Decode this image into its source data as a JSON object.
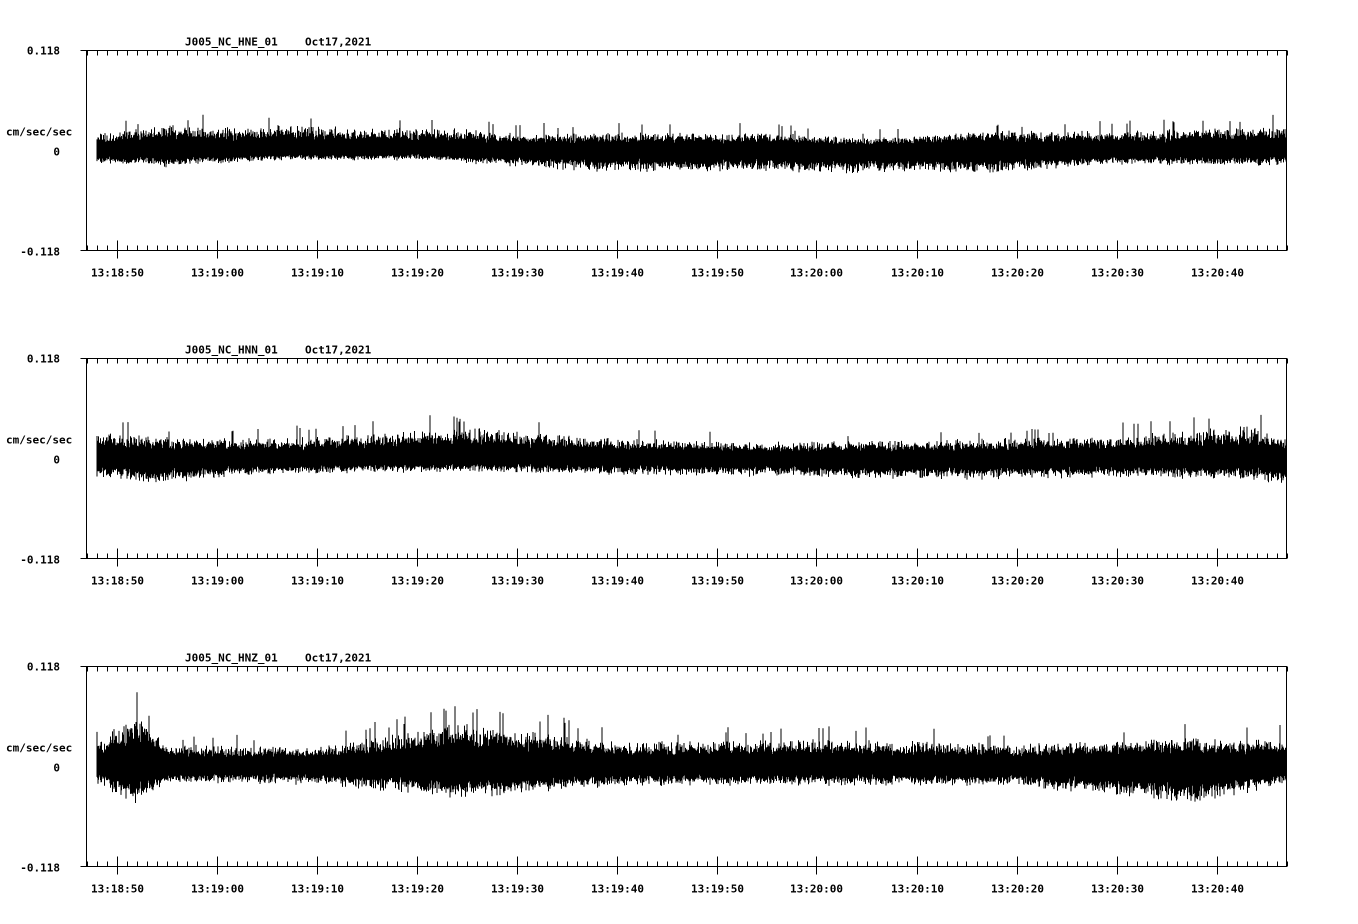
{
  "chart_data": [
    {
      "type": "line",
      "title": "J005_NC_HNE_01",
      "date": "Oct17,2021",
      "ylabel": "cm/sec/sec",
      "ylim": [
        -0.118,
        0.118
      ],
      "yticks": [
        "0.118",
        "0",
        "-0.118"
      ],
      "xlim": [
        "13:18:47",
        "13:20:47"
      ],
      "xticks": [
        "13:18:50",
        "13:19:00",
        "13:19:10",
        "13:19:20",
        "13:19:30",
        "13:19:40",
        "13:19:50",
        "13:20:00",
        "13:20:10",
        "13:20:20",
        "13:20:30",
        "13:20:40"
      ],
      "grid": false,
      "color": "#000000",
      "series": [
        {
          "x_start": "13:18:48",
          "x_end": "13:20:47",
          "envelope": [
            {
              "t": "13:18:48",
              "max": 0.02,
              "min": -0.016
            },
            {
              "t": "13:18:55",
              "max": 0.032,
              "min": -0.02
            },
            {
              "t": "13:19:03",
              "max": 0.028,
              "min": -0.014
            },
            {
              "t": "13:19:07",
              "max": 0.033,
              "min": -0.012
            },
            {
              "t": "13:19:15",
              "max": 0.026,
              "min": -0.012
            },
            {
              "t": "13:19:21",
              "max": 0.031,
              "min": -0.012
            },
            {
              "t": "13:19:28",
              "max": 0.022,
              "min": -0.018
            },
            {
              "t": "13:19:38",
              "max": 0.022,
              "min": -0.026
            },
            {
              "t": "13:19:54",
              "max": 0.022,
              "min": -0.026
            },
            {
              "t": "13:20:05",
              "max": 0.016,
              "min": -0.028
            },
            {
              "t": "13:20:17",
              "max": 0.024,
              "min": -0.028
            },
            {
              "t": "13:20:30",
              "max": 0.024,
              "min": -0.018
            },
            {
              "t": "13:20:47",
              "max": 0.03,
              "min": -0.018
            }
          ]
        }
      ]
    },
    {
      "type": "line",
      "title": "J005_NC_HNN_01",
      "date": "Oct17,2021",
      "ylabel": "cm/sec/sec",
      "ylim": [
        -0.118,
        0.118
      ],
      "yticks": [
        "0.118",
        "0",
        "-0.118"
      ],
      "xlim": [
        "13:18:47",
        "13:20:47"
      ],
      "xticks": [
        "13:18:50",
        "13:19:00",
        "13:19:10",
        "13:19:20",
        "13:19:30",
        "13:19:40",
        "13:19:50",
        "13:20:00",
        "13:20:10",
        "13:20:20",
        "13:20:30",
        "13:20:40"
      ],
      "grid": false,
      "color": "#000000",
      "series": [
        {
          "x_start": "13:18:48",
          "x_end": "13:20:47",
          "envelope": [
            {
              "t": "13:18:48",
              "max": 0.034,
              "min": -0.024
            },
            {
              "t": "13:18:54",
              "max": 0.026,
              "min": -0.03
            },
            {
              "t": "13:19:05",
              "max": 0.024,
              "min": -0.02
            },
            {
              "t": "13:19:26",
              "max": 0.038,
              "min": -0.016
            },
            {
              "t": "13:19:40",
              "max": 0.024,
              "min": -0.02
            },
            {
              "t": "13:19:55",
              "max": 0.02,
              "min": -0.022
            },
            {
              "t": "13:20:10",
              "max": 0.022,
              "min": -0.026
            },
            {
              "t": "13:20:30",
              "max": 0.028,
              "min": -0.024
            },
            {
              "t": "13:20:43",
              "max": 0.04,
              "min": -0.026
            },
            {
              "t": "13:20:47",
              "max": 0.026,
              "min": -0.034
            }
          ]
        }
      ]
    },
    {
      "type": "line",
      "title": "J005_NC_HNZ_01",
      "date": "Oct17,2021",
      "ylabel": "cm/sec/sec",
      "ylim": [
        -0.118,
        0.118
      ],
      "yticks": [
        "0.118",
        "0",
        "-0.118"
      ],
      "xlim": [
        "13:18:47",
        "13:20:47"
      ],
      "xticks": [
        "13:18:50",
        "13:19:00",
        "13:19:10",
        "13:19:20",
        "13:19:30",
        "13:19:40",
        "13:19:50",
        "13:20:00",
        "13:20:10",
        "13:20:20",
        "13:20:30",
        "13:20:40"
      ],
      "grid": false,
      "color": "#000000",
      "series": [
        {
          "x_start": "13:18:48",
          "x_end": "13:20:47",
          "envelope": [
            {
              "t": "13:18:48",
              "max": 0.03,
              "min": -0.02
            },
            {
              "t": "13:18:52",
              "max": 0.068,
              "min": -0.048
            },
            {
              "t": "13:18:55",
              "max": 0.026,
              "min": -0.02
            },
            {
              "t": "13:19:10",
              "max": 0.024,
              "min": -0.022
            },
            {
              "t": "13:19:25",
              "max": 0.054,
              "min": -0.04
            },
            {
              "t": "13:19:40",
              "max": 0.03,
              "min": -0.024
            },
            {
              "t": "13:20:00",
              "max": 0.034,
              "min": -0.024
            },
            {
              "t": "13:20:20",
              "max": 0.028,
              "min": -0.024
            },
            {
              "t": "13:20:38",
              "max": 0.036,
              "min": -0.046
            },
            {
              "t": "13:20:47",
              "max": 0.034,
              "min": -0.022
            }
          ]
        }
      ]
    }
  ]
}
